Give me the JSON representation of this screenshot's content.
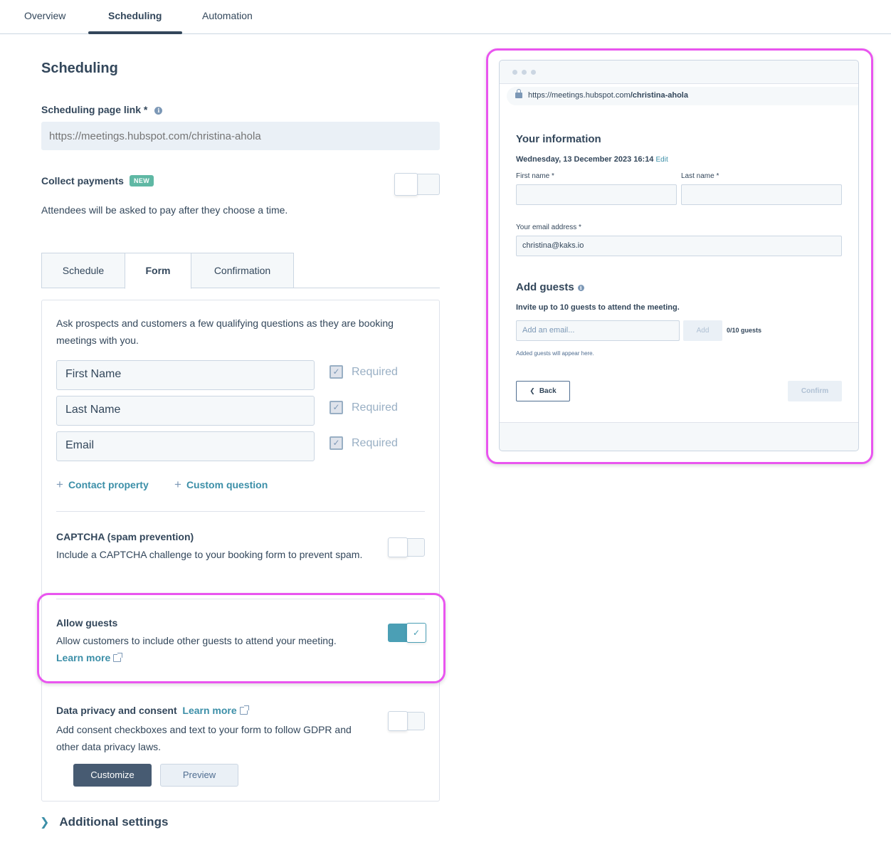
{
  "top_tabs": [
    {
      "label": "Overview",
      "active": false
    },
    {
      "label": "Scheduling",
      "active": true
    },
    {
      "label": "Automation",
      "active": false
    }
  ],
  "page_title": "Scheduling",
  "scheduling_link": {
    "label": "Scheduling page link *",
    "placeholder": "https://meetings.hubspot.com/christina-ahola"
  },
  "collect_payments": {
    "label": "Collect payments",
    "badge": "NEW",
    "description": "Attendees will be asked to pay after they choose a time.",
    "enabled": false
  },
  "sub_tabs": [
    {
      "label": "Schedule",
      "active": false
    },
    {
      "label": "Form",
      "active": true
    },
    {
      "label": "Confirmation",
      "active": false
    }
  ],
  "form": {
    "intro": "Ask prospects and customers a few qualifying questions as they are booking meetings with you.",
    "fields": [
      {
        "label": "First Name",
        "required_label": "Required",
        "required": true
      },
      {
        "label": "Last Name",
        "required_label": "Required",
        "required": true
      },
      {
        "label": "Email",
        "required_label": "Required",
        "required": true
      }
    ],
    "add_contact_property": "Contact property",
    "add_custom_question": "Custom question"
  },
  "captcha": {
    "title": "CAPTCHA (spam prevention)",
    "description": "Include a CAPTCHA challenge to your booking form to prevent spam.",
    "enabled": false
  },
  "allow_guests": {
    "title": "Allow guests",
    "description": "Allow customers to include other guests to attend your meeting.",
    "learn_more": "Learn more",
    "enabled": true
  },
  "data_privacy": {
    "title": "Data privacy and consent",
    "learn_more": "Learn more",
    "description": "Add consent checkboxes and text to your form to follow GDPR and other data privacy laws.",
    "enabled": false,
    "customize_label": "Customize",
    "preview_label": "Preview"
  },
  "additional_settings": "Additional settings",
  "preview": {
    "url_prefix": "https://meetings.hubspot.com",
    "url_path": "/christina-ahola",
    "heading": "Your information",
    "datetime": "Wednesday, 13 December 2023 16:14",
    "edit_label": "Edit",
    "first_name_label": "First name *",
    "last_name_label": "Last name *",
    "first_name_value": "",
    "last_name_value": "",
    "email_label": "Your email address *",
    "email_value": "christina@kaks.io",
    "guests_heading": "Add guests",
    "guests_subtitle": "Invite up to 10 guests to attend the meeting.",
    "guest_email_placeholder": "Add an email...",
    "add_label": "Add",
    "guest_count": "0/10 guests",
    "guests_hint": "Added guests will appear here.",
    "back_label": "Back",
    "confirm_label": "Confirm"
  },
  "colors": {
    "accent": "#3c8fa8",
    "toggle_on": "#4b9fb5",
    "highlight": "#e955ef",
    "text": "#33475b",
    "badge_new": "#5fb8a4"
  }
}
